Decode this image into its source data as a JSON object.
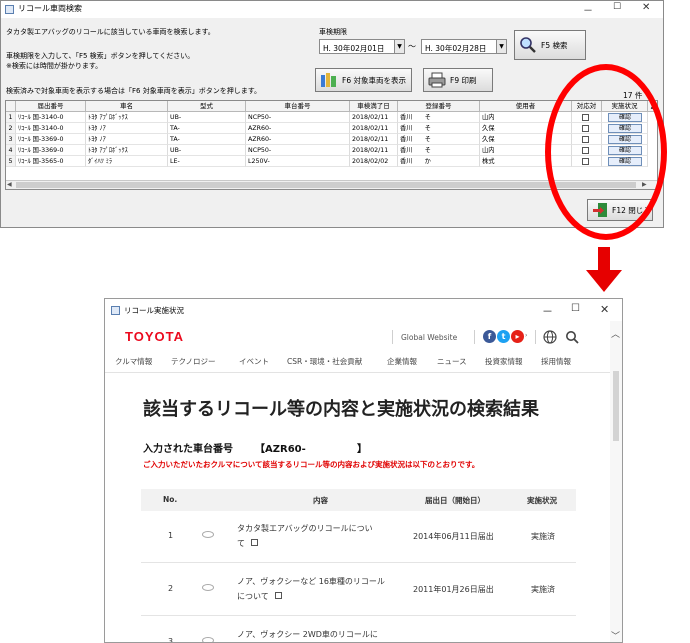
{
  "search_window": {
    "title": "リコール車両検索",
    "window_controls": {
      "minimize": "－",
      "maximize": "☐",
      "close": "✕"
    },
    "instructions": [
      "タカタ製エアバッグのリコールに該当している車両を検索します。",
      "車検期限を入力して、「F5 検索」ボタンを押してください。",
      "※検索には時間が掛かります。"
    ],
    "note_f6": "検索済みで対象車両を表示する場合は「F6 対象車両を表示」ボタンを押します。",
    "period_label": "車検期限",
    "date_from": "H. 30年02月01日",
    "date_to": "H. 30年02月28日",
    "range_sep": "～",
    "btn_search": "F5 検索",
    "btn_show": "F6 対象車両を表示",
    "btn_print": "F9 印刷",
    "count": "17 件",
    "btn_close": "F12 閉じる",
    "columns": [
      "届出番号",
      "車名",
      "型式",
      "車台番号",
      "車検満了日",
      "登録番号",
      "使用者",
      "対応対",
      "実施状況"
    ],
    "rows": [
      {
        "no": "1",
        "notice": "ﾘｺｰﾙ 国-3140-0",
        "car": "ﾄﾖﾀ ｱﾌﾟﾛﾎﾞｯｸｽ",
        "model": "UB-",
        "vin": "NCP50-",
        "date": "2018/02/11",
        "reg1": "香川",
        "reg2": "そ",
        "user": "山内",
        "btn": "確認"
      },
      {
        "no": "2",
        "notice": "ﾘｺｰﾙ 国-3140-0",
        "car": "ﾄﾖﾀ ﾉｱ",
        "model": "TA-",
        "vin": "AZR60-",
        "date": "2018/02/11",
        "reg1": "香川",
        "reg2": "そ",
        "user": "久保",
        "btn": "確認"
      },
      {
        "no": "3",
        "notice": "ﾘｺｰﾙ 国-3369-0",
        "car": "ﾄﾖﾀ ﾉｱ",
        "model": "TA-",
        "vin": "AZR60-",
        "date": "2018/02/11",
        "reg1": "香川",
        "reg2": "そ",
        "user": "久保",
        "btn": "確認"
      },
      {
        "no": "4",
        "notice": "ﾘｺｰﾙ 国-3369-0",
        "car": "ﾄﾖﾀ ｱﾌﾟﾛﾎﾞｯｸｽ",
        "model": "UB-",
        "vin": "NCP50-",
        "date": "2018/02/11",
        "reg1": "香川",
        "reg2": "そ",
        "user": "山内",
        "btn": "確認"
      },
      {
        "no": "5",
        "notice": "ﾘｺｰﾙ 国-3565-0",
        "car": "ﾀﾞｲﾊﾂ ﾐﾗ",
        "model": "LE-",
        "vin": "L250V-",
        "date": "2018/02/02",
        "reg1": "香川",
        "reg2": "か",
        "user": "株式",
        "btn": "確認"
      }
    ]
  },
  "status_window": {
    "title": "リコール実施状況",
    "window_controls": {
      "minimize": "－",
      "maximize": "☐",
      "close": "✕"
    },
    "logo": "TOYOTA",
    "global_website": "Global Website",
    "nav": [
      "クルマ情報",
      "テクノロジー",
      "イベント",
      "CSR・環境・社会貢献",
      "企業情報",
      "ニュース",
      "投資家情報",
      "採用情報"
    ],
    "heading": "該当するリコール等の内容と実施状況の検索結果",
    "vin_label": "入力された車台番号",
    "vin_value": "【AZR60-",
    "vin_close": "】",
    "notice": "ご入力いただいたおクルマについて該当するリコール等の内容および実施状況は以下のとおりです。",
    "table_headers": [
      "No.",
      "内容",
      "届出日（開始日）",
      "実施状況"
    ],
    "items": [
      {
        "no": "1",
        "line1": "タカタ製エアバッグのリコールについ",
        "line2": "て",
        "date": "2014年06月11日届出",
        "status": "実施済"
      },
      {
        "no": "2",
        "line1": "ノア、ヴォクシーなど 16車種のリコール",
        "line2": "について",
        "date": "2011年01月26日届出",
        "status": "実施済"
      },
      {
        "no": "3",
        "line1": "ノア、ヴォクシー 2WD車のリコールに",
        "line2": "",
        "date": "",
        "status": ""
      }
    ]
  },
  "colors": {
    "accent_red": "#e60000",
    "toyota_red": "#eb0a1e",
    "notice_red": "#e00000"
  },
  "icons": [
    "search-icon",
    "books-icon",
    "printer-icon",
    "exit-door-icon",
    "globe-icon",
    "magnifier-icon",
    "external-link-icon"
  ]
}
